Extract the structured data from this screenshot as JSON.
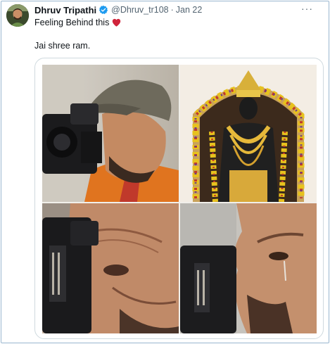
{
  "post": {
    "author_name": "Dhruv Tripathi",
    "handle": "@Dhruv_tr108",
    "separator": "·",
    "date": "Jan 22",
    "line1": "Feeling Behind this",
    "line2": "Jai shree ram.",
    "more_label": "···"
  },
  "icons": {
    "verified": "verified-badge-icon",
    "heart": "red-heart-emoji",
    "more": "more-options-icon"
  },
  "colors": {
    "verified_blue": "#1d9bf0",
    "heart_red": "#d0243b",
    "secondary_text": "#536471"
  }
}
